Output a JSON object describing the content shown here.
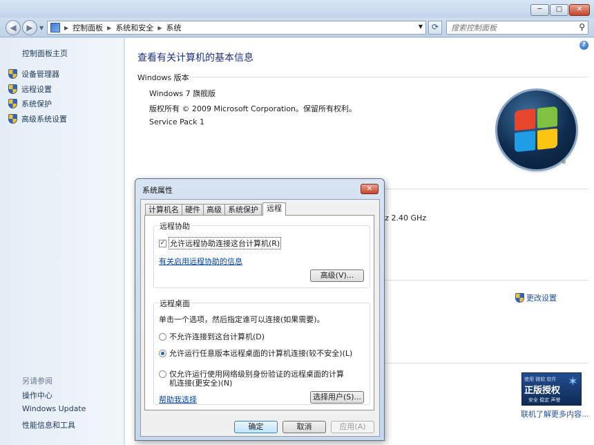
{
  "window": {
    "minimize": "─",
    "maximize": "□",
    "close": "✕"
  },
  "nav": {
    "back": "◀",
    "forward": "▶",
    "breadcrumbs": [
      "控制面板",
      "系统和安全",
      "系统"
    ],
    "search_placeholder": "搜索控制面板",
    "refresh": "⟳"
  },
  "sidebar": {
    "home": "控制面板主页",
    "items": [
      {
        "label": "设备管理器",
        "icon": "shield-icon"
      },
      {
        "label": "远程设置",
        "icon": "shield-icon"
      },
      {
        "label": "系统保护",
        "icon": "shield-icon"
      },
      {
        "label": "高级系统设置",
        "icon": "shield-icon"
      }
    ],
    "see_also_title": "另请参阅",
    "see_also": [
      "操作中心",
      "Windows Update",
      "性能信息和工具"
    ]
  },
  "main": {
    "title": "查看有关计算机的基本信息",
    "edition_header": "Windows 版本",
    "edition": "Windows 7 旗舰版",
    "copyright": "版权所有 © 2009 Microsoft Corporation。保留所有权利。",
    "service_pack": "Service Pack 1",
    "cpu_partial": "Hz   2.40 GHz",
    "change_settings": "更改设置",
    "genuine": {
      "top": "使用 微软 软件",
      "main": "正版授权",
      "sub": "安全 稳定 声誉"
    },
    "learn_more": "联机了解更多内容...",
    "help": "?",
    "tm": "®"
  },
  "dialog": {
    "title": "系统属性",
    "close": "✕",
    "tabs": [
      "计算机名",
      "硬件",
      "高级",
      "系统保护",
      "远程"
    ],
    "active_tab": "远程",
    "remote_assist": {
      "label": "远程协助",
      "checkbox": "允许远程协助连接这台计算机(R)",
      "checked": true,
      "link": "有关启用远程协助的信息",
      "advanced_button": "高级(V)..."
    },
    "remote_desktop": {
      "label": "远程桌面",
      "description": "单击一个选项，然后指定谁可以连接(如果需要)。",
      "option1": "不允许连接到这台计算机(D)",
      "option2": "允许运行任意版本远程桌面的计算机连接(较不安全)(L)",
      "option3_line1": "仅允许运行使用网络级别身份验证的远程桌面的计算",
      "option3_line2": "机连接(更安全)(N)",
      "selected": 2,
      "help_link": "帮助我选择",
      "select_users_button": "选择用户(S)..."
    },
    "buttons": {
      "ok": "确定",
      "cancel": "取消",
      "apply": "应用(A)"
    }
  }
}
